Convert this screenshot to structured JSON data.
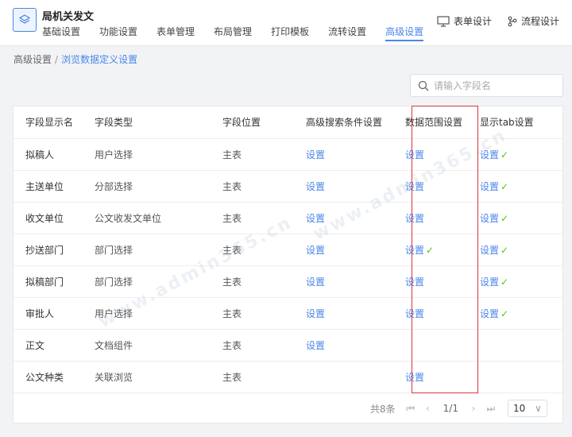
{
  "app": {
    "title": "局机关发文"
  },
  "nav": {
    "tabs": [
      {
        "label": "基础设置"
      },
      {
        "label": "功能设置"
      },
      {
        "label": "表单管理"
      },
      {
        "label": "布局管理"
      },
      {
        "label": "打印模板"
      },
      {
        "label": "流转设置"
      },
      {
        "label": "高级设置"
      }
    ],
    "active_index": 6
  },
  "actions": {
    "form_design": "表单设计",
    "flow_design": "流程设计"
  },
  "breadcrumb": {
    "parent": "高级设置",
    "separator": "/",
    "current": "浏览数据定义设置"
  },
  "search": {
    "placeholder": "请输入字段名",
    "value": ""
  },
  "table": {
    "headers": [
      "字段显示名",
      "字段类型",
      "字段位置",
      "高级搜索条件设置",
      "数据范围设置",
      "显示tab设置"
    ],
    "rows": [
      {
        "name": "拟稿人",
        "type": "用户选择",
        "position": "主表",
        "search": "设置",
        "range": "设置",
        "range_checked": false,
        "tab": "设置",
        "tab_checked": true
      },
      {
        "name": "主送单位",
        "type": "分部选择",
        "position": "主表",
        "search": "设置",
        "range": "设置",
        "range_checked": false,
        "tab": "设置",
        "tab_checked": true
      },
      {
        "name": "收文单位",
        "type": "公文收发文单位",
        "position": "主表",
        "search": "设置",
        "range": "设置",
        "range_checked": false,
        "tab": "设置",
        "tab_checked": true
      },
      {
        "name": "抄送部门",
        "type": "部门选择",
        "position": "主表",
        "search": "设置",
        "range": "设置",
        "range_checked": true,
        "tab": "设置",
        "tab_checked": true
      },
      {
        "name": "拟稿部门",
        "type": "部门选择",
        "position": "主表",
        "search": "设置",
        "range": "设置",
        "range_checked": false,
        "tab": "设置",
        "tab_checked": true
      },
      {
        "name": "审批人",
        "type": "用户选择",
        "position": "主表",
        "search": "设置",
        "range": "设置",
        "range_checked": false,
        "tab": "设置",
        "tab_checked": true
      },
      {
        "name": "正文",
        "type": "文档组件",
        "position": "主表",
        "search": "设置",
        "range": "",
        "range_checked": false,
        "tab": "",
        "tab_checked": false
      },
      {
        "name": "公文种类",
        "type": "关联浏览",
        "position": "主表",
        "search": "",
        "range": "设置",
        "range_checked": false,
        "tab": "",
        "tab_checked": false
      }
    ]
  },
  "pager": {
    "total": "共8条",
    "page": "1/1",
    "page_size": "10"
  },
  "watermark": "www.admin365.cn",
  "colors": {
    "accent": "#4a86e8",
    "check": "#52c41a",
    "highlight": "#d9363e"
  },
  "icons": {
    "check": "✓"
  }
}
